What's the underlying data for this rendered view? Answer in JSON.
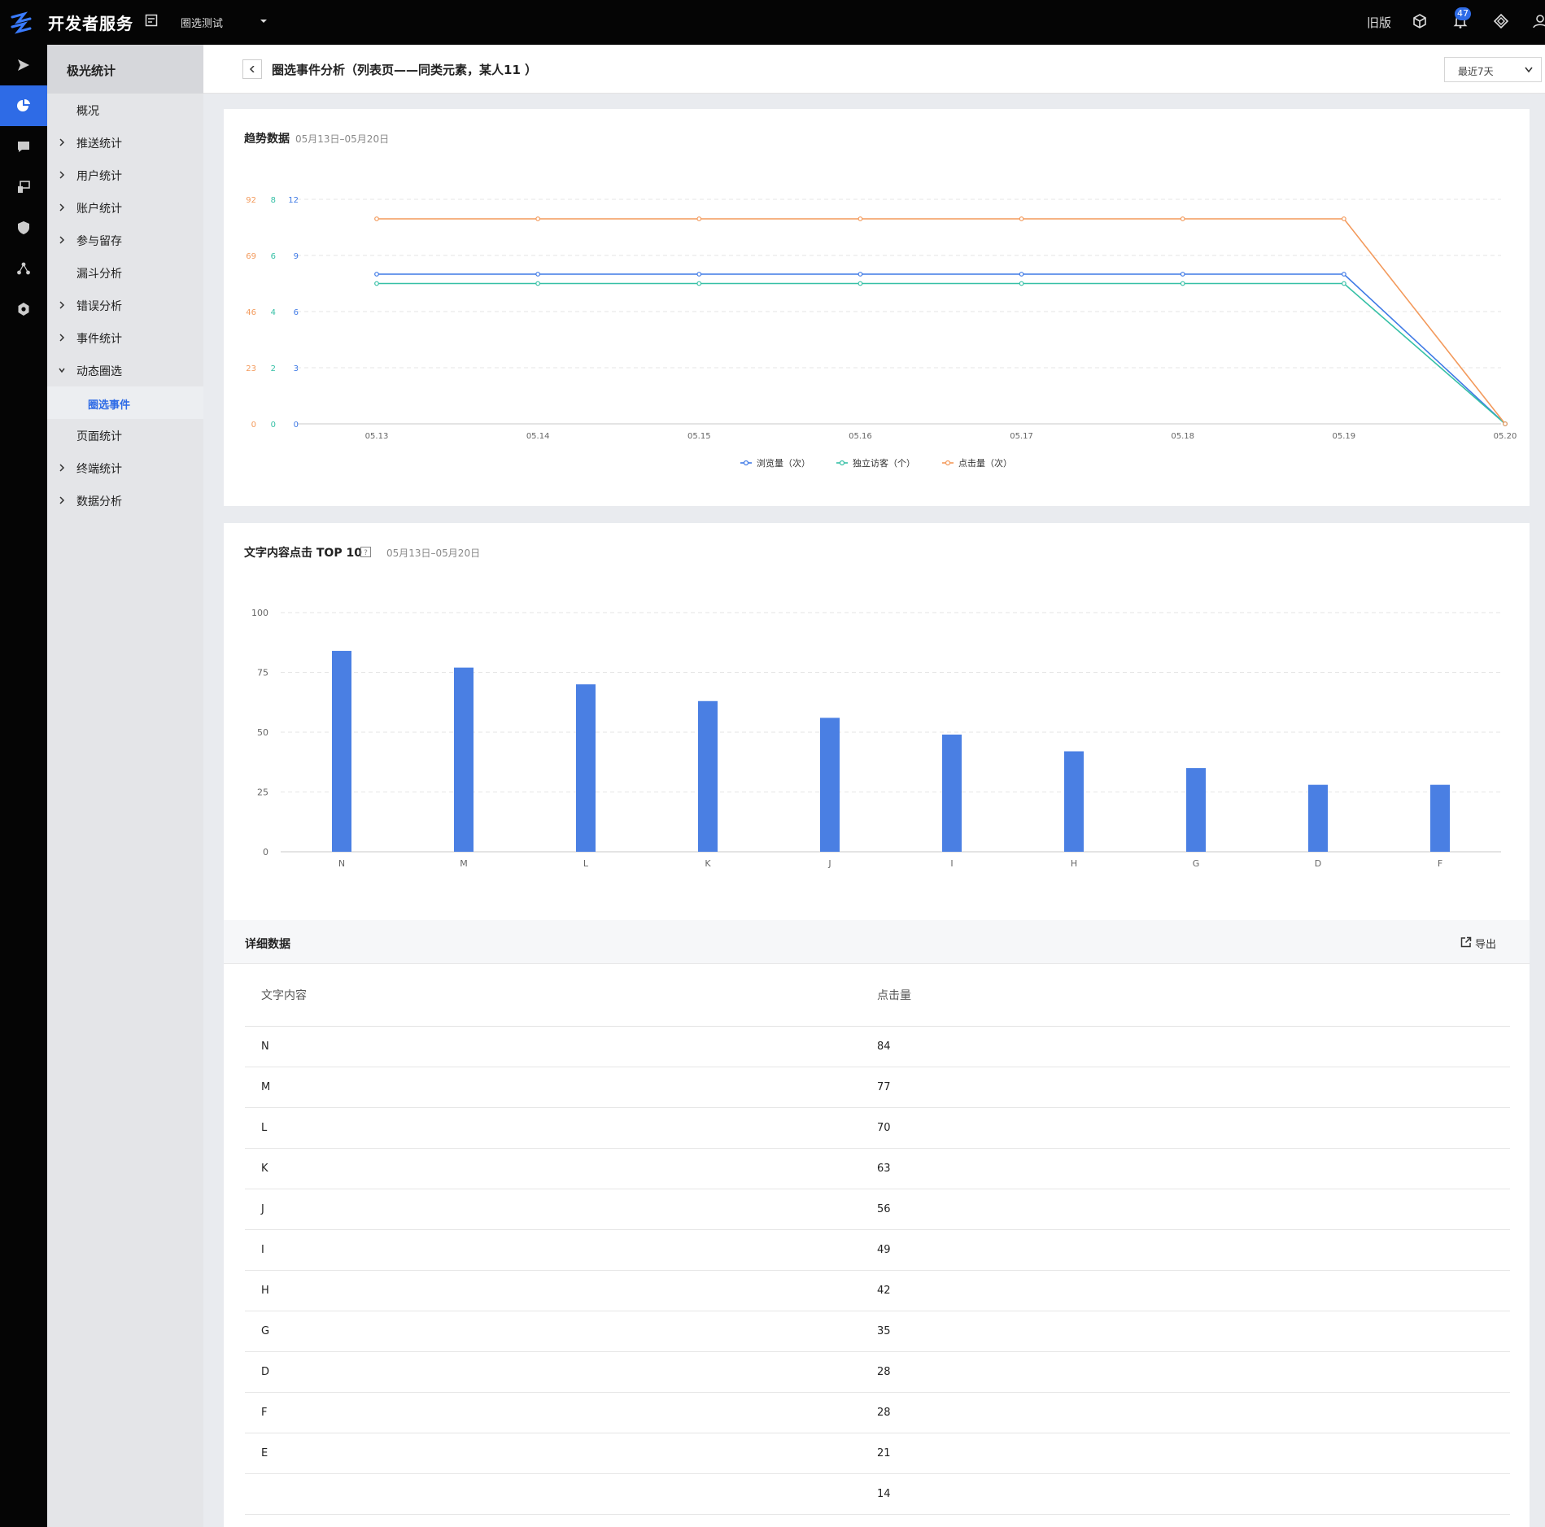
{
  "topbar": {
    "brand": "开发者服务",
    "project": "圈选测试",
    "old_version": "旧版",
    "notification_count": "47"
  },
  "sidebar": {
    "title": "极光统计",
    "items": [
      {
        "label": "概况",
        "arrow": "none"
      },
      {
        "label": "推送统计",
        "arrow": "right"
      },
      {
        "label": "用户统计",
        "arrow": "right"
      },
      {
        "label": "账户统计",
        "arrow": "right"
      },
      {
        "label": "参与留存",
        "arrow": "right"
      },
      {
        "label": "漏斗分析",
        "arrow": "none"
      },
      {
        "label": "错误分析",
        "arrow": "right"
      },
      {
        "label": "事件统计",
        "arrow": "right"
      },
      {
        "label": "动态圈选",
        "arrow": "down"
      },
      {
        "label": "圈选事件",
        "arrow": "none",
        "sub": true
      },
      {
        "label": "页面统计",
        "arrow": "none"
      },
      {
        "label": "终端统计",
        "arrow": "right"
      },
      {
        "label": "数据分析",
        "arrow": "right"
      }
    ]
  },
  "page": {
    "title": "圈选事件分析（列表页——同类元素，某人11 ）",
    "range": "最近7天"
  },
  "trend": {
    "title": "趋势数据",
    "date_range": "05月13日–05月20日"
  },
  "top10": {
    "title": "文字内容点击 TOP 10",
    "date_range": "05月13日–05月20日"
  },
  "detail": {
    "title": "详细数据",
    "export_label": "导出",
    "columns": [
      "文字内容",
      "点击量"
    ],
    "rows": [
      [
        "N",
        "84"
      ],
      [
        "M",
        "77"
      ],
      [
        "L",
        "70"
      ],
      [
        "K",
        "63"
      ],
      [
        "J",
        "56"
      ],
      [
        "I",
        "49"
      ],
      [
        "H",
        "42"
      ],
      [
        "G",
        "35"
      ],
      [
        "D",
        "28"
      ],
      [
        "F",
        "28"
      ],
      [
        "E",
        "21"
      ],
      [
        "",
        "14"
      ]
    ]
  },
  "colors": {
    "accent": "#2e6be6",
    "series_views": "#3f7ae6",
    "series_visitors": "#36c0a6",
    "series_clicks": "#f39a5c",
    "bar": "#4a7fe3"
  },
  "chart_data": [
    {
      "type": "line",
      "title": "趋势数据",
      "x": [
        "05.13",
        "05.14",
        "05.15",
        "05.16",
        "05.17",
        "05.18",
        "05.19",
        "05.20"
      ],
      "axes": [
        {
          "ticks": [
            "0",
            "23",
            "46",
            "69",
            "92"
          ],
          "ylim": [
            0,
            92
          ],
          "color": "#f39a5c"
        },
        {
          "ticks": [
            "0",
            "2",
            "4",
            "6",
            "8"
          ],
          "ylim": [
            0,
            8
          ],
          "color": "#36c0a6"
        },
        {
          "ticks": [
            "0",
            "3",
            "6",
            "9",
            "12"
          ],
          "ylim": [
            0,
            12
          ],
          "color": "#3f7ae6"
        }
      ],
      "series": [
        {
          "name": "浏览量（次）",
          "axis": 2,
          "color": "#3f7ae6",
          "values": [
            8,
            8,
            8,
            8,
            8,
            8,
            8,
            0
          ]
        },
        {
          "name": "独立访客（个）",
          "axis": 1,
          "color": "#36c0a6",
          "values": [
            5,
            5,
            5,
            5,
            5,
            5,
            5,
            0
          ]
        },
        {
          "name": "点击量（次）",
          "axis": 0,
          "color": "#f39a5c",
          "values": [
            84,
            84,
            84,
            84,
            84,
            84,
            84,
            0
          ]
        }
      ],
      "grid": true,
      "legend": "bottom"
    },
    {
      "type": "bar",
      "title": "文字内容点击 TOP 10",
      "categories": [
        "N",
        "M",
        "L",
        "K",
        "J",
        "I",
        "H",
        "G",
        "D",
        "F"
      ],
      "values": [
        84,
        77,
        70,
        63,
        56,
        49,
        42,
        35,
        28,
        28
      ],
      "yticks": [
        "0",
        "25",
        "50",
        "75",
        "100"
      ],
      "ylim": [
        0,
        100
      ],
      "grid": true
    }
  ]
}
